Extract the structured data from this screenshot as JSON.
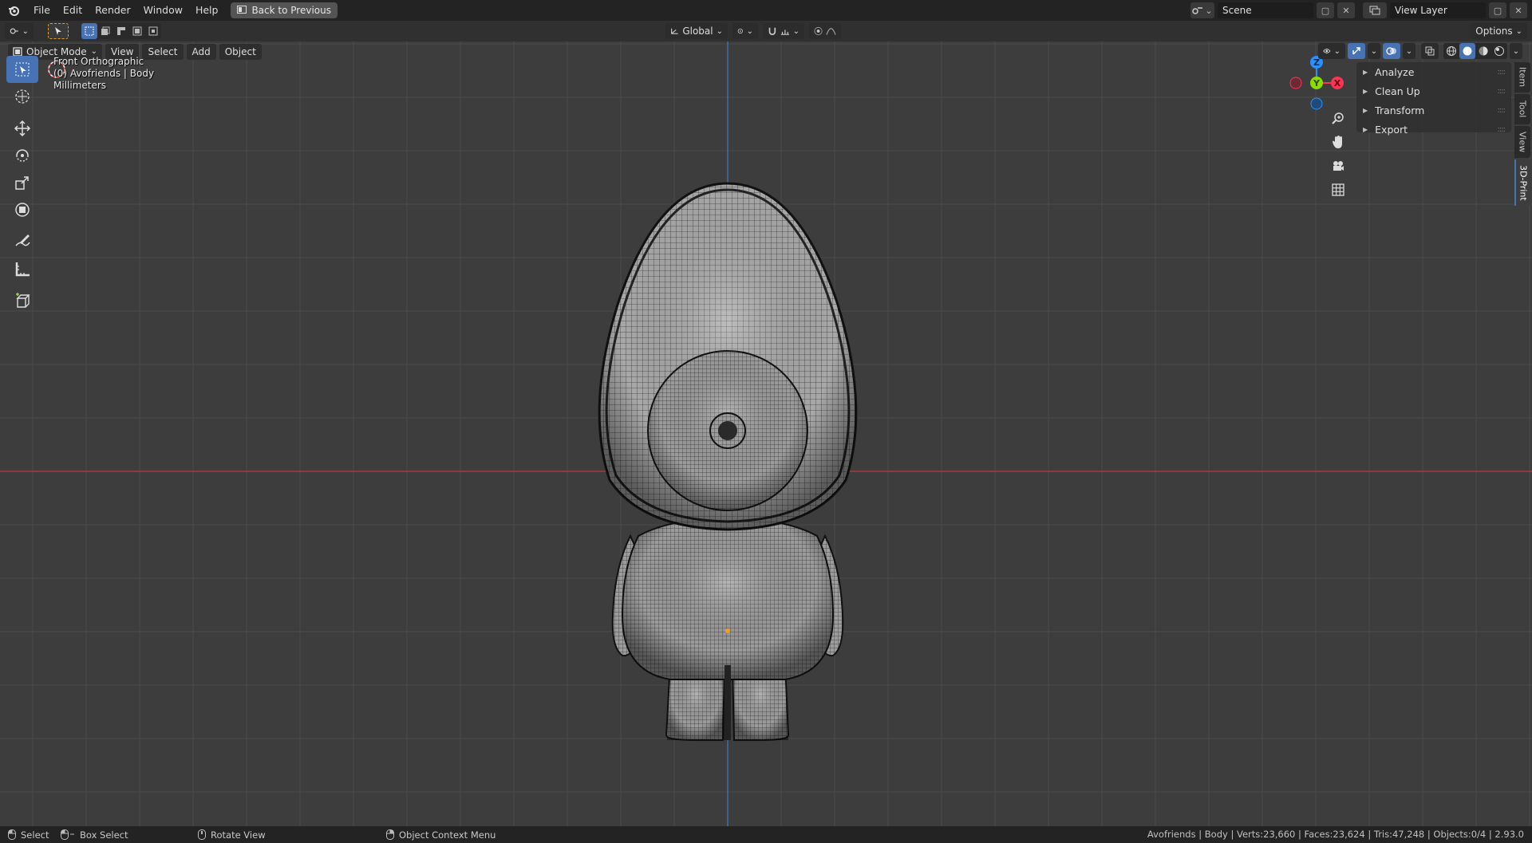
{
  "topbar": {
    "menus": [
      "File",
      "Edit",
      "Render",
      "Window",
      "Help"
    ],
    "back_button": "Back to Previous",
    "scene_name": "Scene",
    "view_layer": "View Layer"
  },
  "toolheader": {
    "transform_orientation": "Global",
    "options_label": "Options"
  },
  "viewport": {
    "mode": "Object Mode",
    "menus": [
      "View",
      "Select",
      "Add",
      "Object"
    ],
    "overlay": {
      "view_name": "Front Orthographic",
      "object_info": "(0) Avofriends | Body",
      "units": "Millimeters"
    },
    "gizmo": {
      "z": "Z",
      "y": "Y",
      "x": "X"
    }
  },
  "npanel": {
    "sections": [
      "Analyze",
      "Clean Up",
      "Transform",
      "Export"
    ],
    "tabs": [
      "Item",
      "Tool",
      "View",
      "3D-Print"
    ],
    "active_tab": "3D-Print"
  },
  "statusbar": {
    "select": "Select",
    "box_select": "Box Select",
    "rotate_view": "Rotate View",
    "context_menu": "Object Context Menu",
    "stats": "Avofriends | Body | Verts:23,660 | Faces:23,624 | Tris:47,248 | Objects:0/4 | 2.93.0"
  },
  "colors": {
    "accent": "#4772b3",
    "viewport_bg": "#3d3d3d",
    "x_axis": "#ff3352",
    "y_axis": "#8bdc00",
    "z_axis": "#2890ff"
  }
}
